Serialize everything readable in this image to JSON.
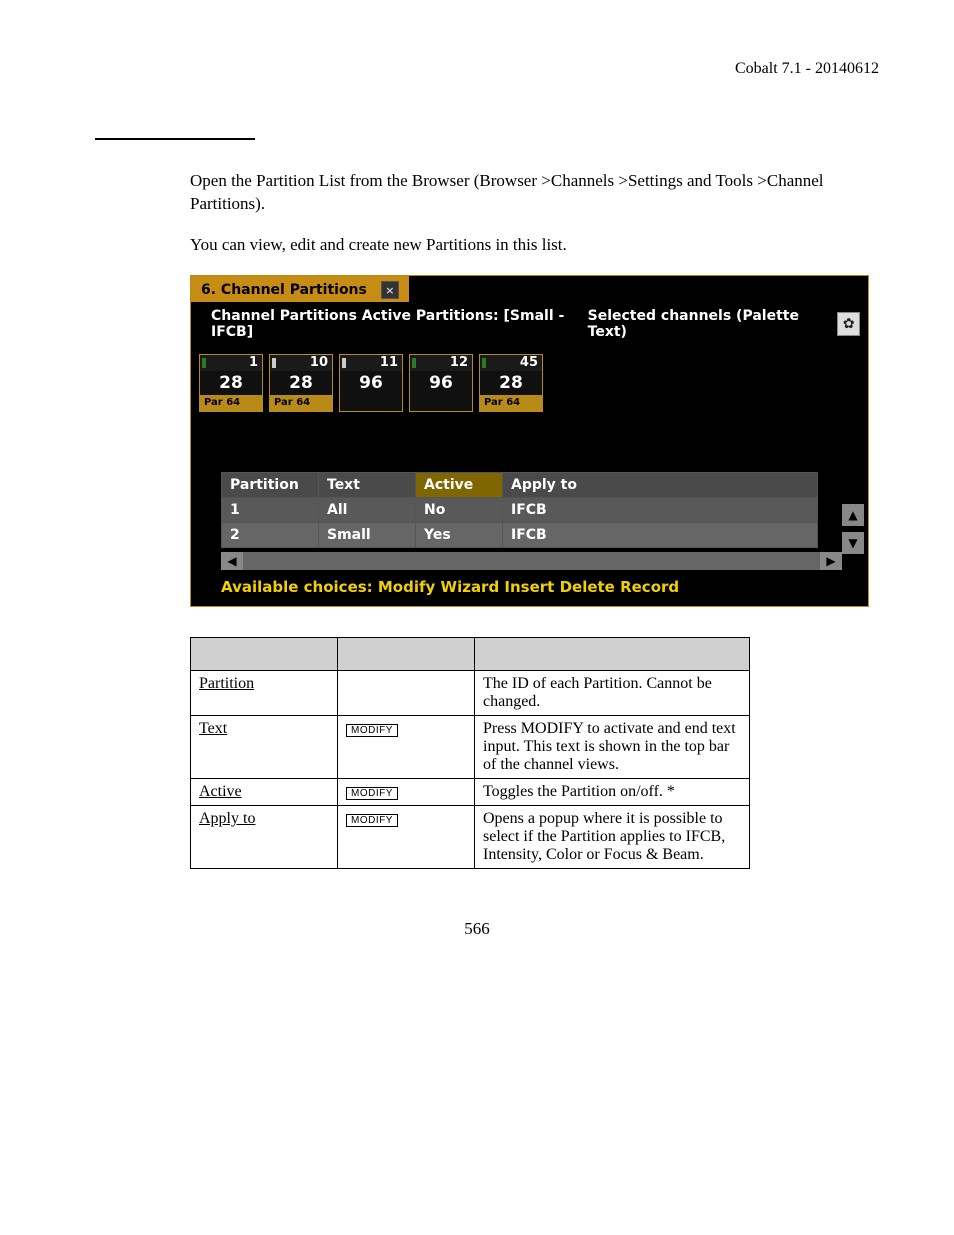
{
  "header": {
    "doc_title": "Cobalt 7.1 - 20140612"
  },
  "body": {
    "p1": "Open the Partition List from the Browser (Browser >Channels >Settings and Tools >Channel Partitions).",
    "p2": "You can view, edit and create new Partitions in this list."
  },
  "panel": {
    "tab_title": "6. Channel Partitions",
    "close_glyph": "×",
    "heading_left": "Channel Partitions   Active Partitions: [Small - IFCB]",
    "heading_right": "Selected channels (Palette Text)",
    "gear_glyph": "✿",
    "channels": [
      {
        "num": "1",
        "val": "28",
        "label": "Par 64",
        "mark": "green"
      },
      {
        "num": "10",
        "val": "28",
        "label": "Par 64",
        "mark": "white"
      },
      {
        "num": "11",
        "val": "96",
        "label": "",
        "mark": "white"
      },
      {
        "num": "12",
        "val": "96",
        "label": "",
        "mark": "green"
      },
      {
        "num": "45",
        "val": "28",
        "label": "Par 64",
        "mark": "green"
      }
    ],
    "part_table": {
      "cols": {
        "c1": "Partition",
        "c2": "Text",
        "c3": "Active",
        "c4": "Apply to"
      },
      "rows": [
        {
          "c1": "1",
          "c2": "All",
          "c3": "No",
          "c4": "IFCB"
        },
        {
          "c1": "2",
          "c2": "Small",
          "c3": "Yes",
          "c4": "IFCB"
        }
      ]
    },
    "available": "Available choices: Modify Wizard Insert Delete Record"
  },
  "ref": {
    "btn": "MODIFY",
    "rows": [
      {
        "name": "Partition",
        "btn": "",
        "desc": "The ID of each Partition. Cannot be changed."
      },
      {
        "name": "Text",
        "btn": "MODIFY",
        "desc": "Press MODIFY to activate and end text input. This text is shown in the top bar of the channel views."
      },
      {
        "name": "Active",
        "btn": "MODIFY",
        "desc": "Toggles the Partition on/off. *"
      },
      {
        "name": "Apply to",
        "btn": "MODIFY",
        "desc": "Opens a popup where it is possible to select if the Partition applies to IFCB, Intensity, Color or Focus & Beam."
      }
    ]
  },
  "page_num": "566"
}
